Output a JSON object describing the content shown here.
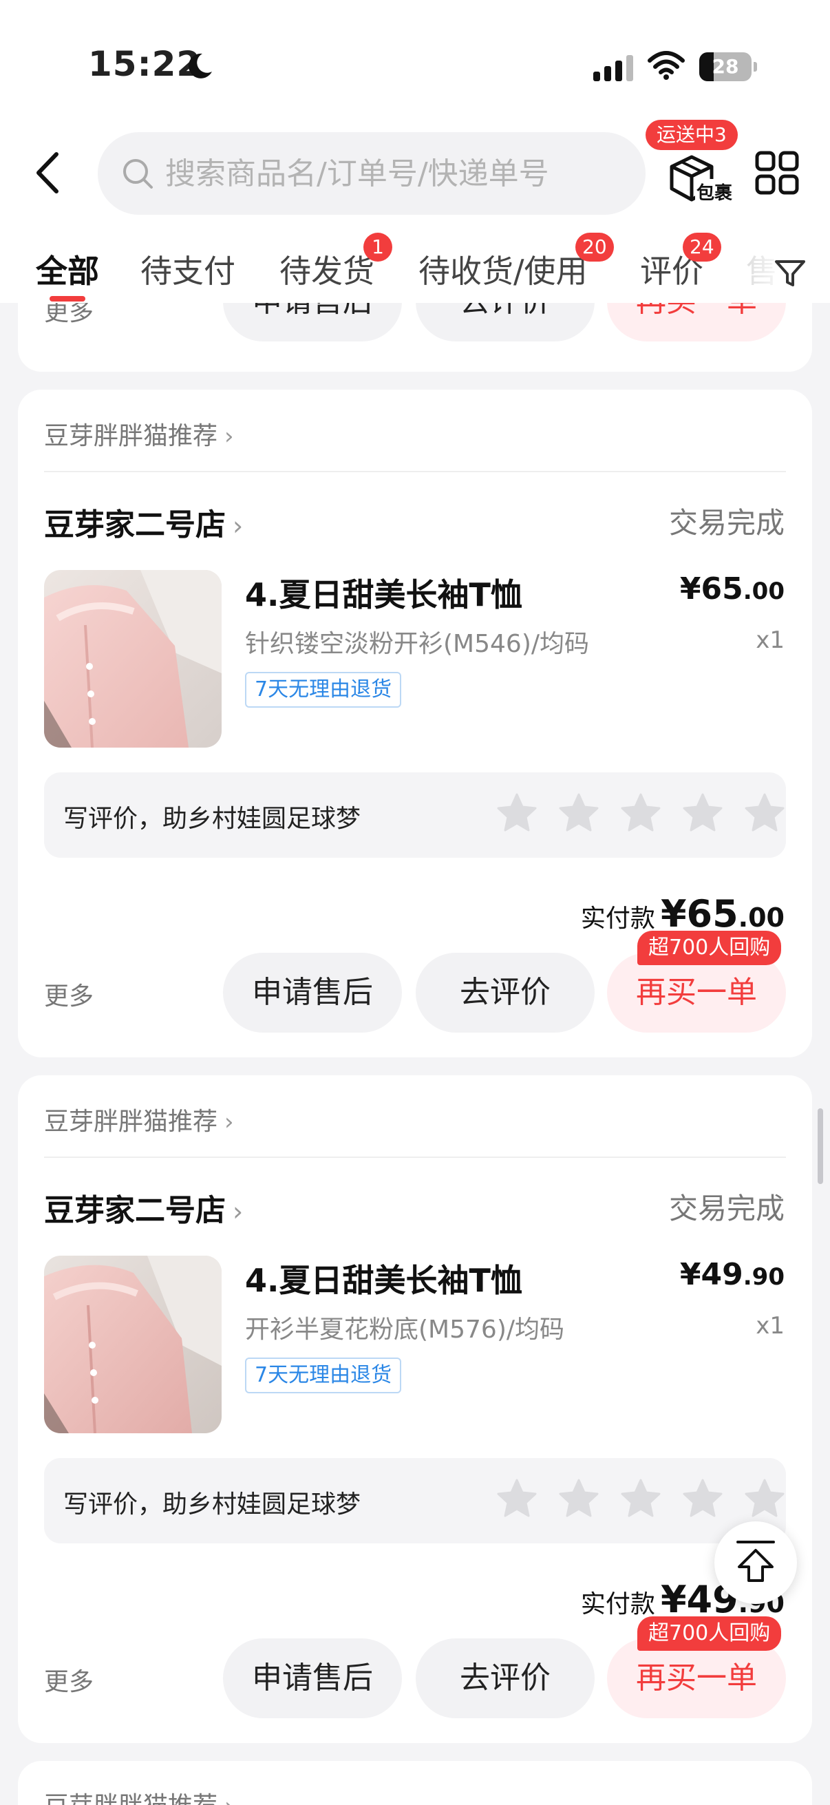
{
  "status_bar": {
    "time": "15:22",
    "battery": "28",
    "battery_level": 0.28
  },
  "header": {
    "search_placeholder": "搜索商品名/订单号/快递单号",
    "shipping_badge": "运送中3",
    "package_label": "包裹"
  },
  "tabs": [
    {
      "label": "全部",
      "active": true
    },
    {
      "label": "待支付"
    },
    {
      "label": "待发货",
      "badge": "1"
    },
    {
      "label": "待收货/使用",
      "badge": "20"
    },
    {
      "label": "评价",
      "badge": "24"
    },
    {
      "label": "售"
    }
  ],
  "top_partial": {
    "more": "更多",
    "after_sale": "申请售后",
    "evaluate": "去评价",
    "rebuy": "再买一单"
  },
  "orders": [
    {
      "recommend": "豆芽胖胖猫推荐",
      "store": "豆芽家二号店",
      "status": "交易完成",
      "product_name": "4.夏日甜美长袖T恤",
      "spec": "针织镂空淡粉开衫(M546)/均码",
      "tag": "7天无理由退货",
      "price_main": "¥65",
      "price_cents": ".00",
      "qty": "x1",
      "review_prompt": "写评价，助乡村娃圆足球梦",
      "rating": 0,
      "paid_label": "实付款",
      "paid_main": "¥65",
      "paid_cents": ".00",
      "rebuy_badge": "超700人回购",
      "more": "更多",
      "after_sale": "申请售后",
      "evaluate": "去评价",
      "rebuy": "再买一单"
    },
    {
      "recommend": "豆芽胖胖猫推荐",
      "store": "豆芽家二号店",
      "status": "交易完成",
      "product_name": "4.夏日甜美长袖T恤",
      "spec": "开衫半夏花粉底(M576)/均码",
      "tag": "7天无理由退货",
      "price_main": "¥49",
      "price_cents": ".90",
      "qty": "x1",
      "review_prompt": "写评价，助乡村娃圆足球梦",
      "rating": 0,
      "paid_label": "实付款",
      "paid_main": "¥49",
      "paid_cents": ".90",
      "rebuy_badge": "超700人回购",
      "more": "更多",
      "after_sale": "申请售后",
      "evaluate": "去评价",
      "rebuy": "再买一单"
    }
  ],
  "bottom_partial": {
    "recommend": "豆芽胖胖猫推荐"
  },
  "colors": {
    "accent": "#f23d3d",
    "tag_blue": "#2b87e6",
    "background": "#f4f4f6"
  }
}
